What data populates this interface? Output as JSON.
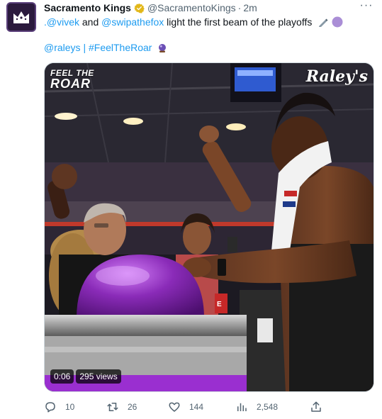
{
  "tweet": {
    "author_name": "Sacramento Kings",
    "handle": "@SacramentoKings",
    "separator": "·",
    "time": "2m",
    "more_label": "···",
    "line1": {
      "mention1": ".@vivek",
      "word_and": " and ",
      "mention2": "@swipathefox",
      "rest": " light the first beam of the playoffs"
    },
    "line2": {
      "mention": "@raleys",
      "separator": " | ",
      "hashtag": "#FeelTheRoar"
    }
  },
  "media": {
    "logo_line1": "FEEL THE",
    "logo_line2": "ROAR",
    "sponsor": "Raley's",
    "duration": "0:06",
    "views": "295 views",
    "emblem_letter": "E"
  },
  "actions": {
    "replies": "10",
    "retweets": "26",
    "likes": "144",
    "views": "2,548"
  },
  "colors": {
    "link": "#1d9bf0",
    "muted": "#536471",
    "verified": "#e2b719",
    "kings_purple": "#5a2d82",
    "button_purple": "#8a2bb8"
  },
  "icons": [
    "crown-icon",
    "verified-badge-icon",
    "more-icon",
    "pencil-icon",
    "purple-circle-icon",
    "crystal-ball-icon",
    "reply-icon",
    "retweet-icon",
    "like-icon",
    "views-icon",
    "share-icon"
  ]
}
